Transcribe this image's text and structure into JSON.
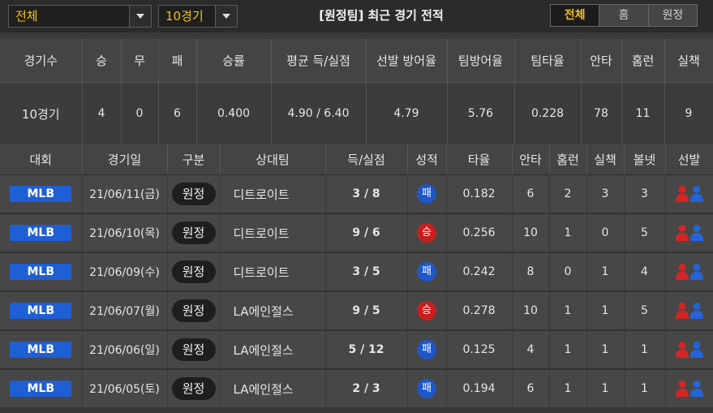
{
  "filters": {
    "scope_select": "전체",
    "count_select": "10경기"
  },
  "title": "[원정팀] 최근 경기 전적",
  "tabs": [
    {
      "label": "전체",
      "active": true
    },
    {
      "label": "홈",
      "active": false
    },
    {
      "label": "원정",
      "active": false
    }
  ],
  "summary": {
    "headers": [
      "경기수",
      "승",
      "무",
      "패",
      "승률",
      "평균 득/실점",
      "선발 방어율",
      "팀방어율",
      "팀타율",
      "안타",
      "홈런",
      "실책"
    ],
    "values": [
      "10경기",
      "4",
      "0",
      "6",
      "0.400",
      "4.90 / 6.40",
      "4.79",
      "5.76",
      "0.228",
      "78",
      "11",
      "9"
    ]
  },
  "games": {
    "headers": [
      "대회",
      "경기일",
      "구분",
      "상대팀",
      "득/실점",
      "성적",
      "타율",
      "안타",
      "홈런",
      "실책",
      "볼넷",
      "선발"
    ],
    "rows": [
      {
        "league": "MLB",
        "date": "21/06/11(금)",
        "type": "원정",
        "opponent": "디트로이트",
        "score": "3 / 8",
        "result": "패",
        "result_kind": "loss",
        "avg": "0.182",
        "hits": "6",
        "hr": "2",
        "errors": "3",
        "walks": "3"
      },
      {
        "league": "MLB",
        "date": "21/06/10(목)",
        "type": "원정",
        "opponent": "디트로이트",
        "score": "9 / 6",
        "result": "승",
        "result_kind": "win",
        "avg": "0.256",
        "hits": "10",
        "hr": "1",
        "errors": "0",
        "walks": "5"
      },
      {
        "league": "MLB",
        "date": "21/06/09(수)",
        "type": "원정",
        "opponent": "디트로이트",
        "score": "3 / 5",
        "result": "패",
        "result_kind": "loss",
        "avg": "0.242",
        "hits": "8",
        "hr": "0",
        "errors": "1",
        "walks": "4"
      },
      {
        "league": "MLB",
        "date": "21/06/07(월)",
        "type": "원정",
        "opponent": "LA에인절스",
        "score": "9 / 5",
        "result": "승",
        "result_kind": "win",
        "avg": "0.278",
        "hits": "10",
        "hr": "1",
        "errors": "1",
        "walks": "5"
      },
      {
        "league": "MLB",
        "date": "21/06/06(일)",
        "type": "원정",
        "opponent": "LA에인절스",
        "score": "5 / 12",
        "result": "패",
        "result_kind": "loss",
        "avg": "0.125",
        "hits": "4",
        "hr": "1",
        "errors": "1",
        "walks": "1"
      },
      {
        "league": "MLB",
        "date": "21/06/05(토)",
        "type": "원정",
        "opponent": "LA에인절스",
        "score": "2 / 3",
        "result": "패",
        "result_kind": "loss",
        "avg": "0.194",
        "hits": "6",
        "hr": "1",
        "errors": "1",
        "walks": "1"
      }
    ]
  },
  "icons": {
    "home_starter": "red-person-icon",
    "away_starter": "blue-person-icon"
  },
  "colors": {
    "accent": "#f0c419",
    "league_badge": "#1f5fd6",
    "win": "#c81e1e",
    "loss": "#1f57c8",
    "person_red": "#d42525",
    "person_blue": "#2563d9"
  }
}
